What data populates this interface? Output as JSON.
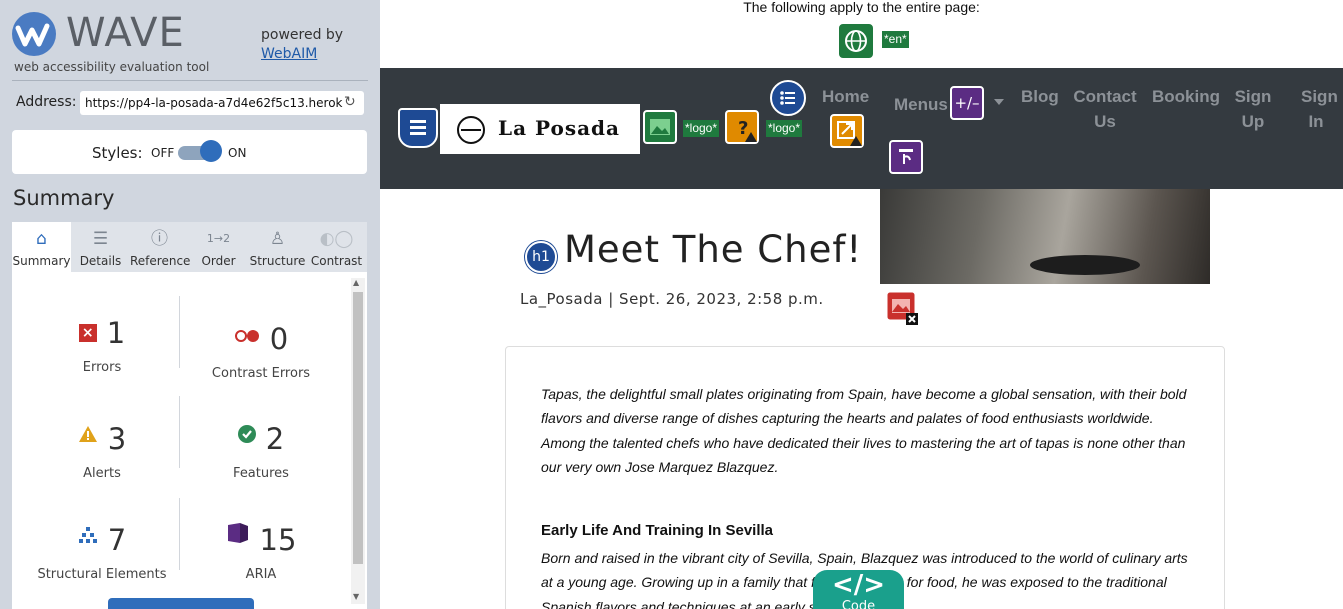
{
  "wave": {
    "name": "WAVE",
    "tagline": "web accessibility evaluation tool",
    "powered_by": "powered by",
    "webaim": "WebAIM",
    "address_label": "Address:",
    "address_value": "https://pp4-la-posada-a7d4e62f5c13.herok",
    "styles_label": "Styles:",
    "styles_off": "OFF",
    "styles_on": "ON",
    "summary_heading": "Summary",
    "tabs": [
      {
        "label": "Summary",
        "icon": "home-icon"
      },
      {
        "label": "Details",
        "icon": "list-icon"
      },
      {
        "label": "Reference",
        "icon": "info-icon"
      },
      {
        "label": "Order",
        "icon": "order-icon"
      },
      {
        "label": "Structure",
        "icon": "structure-icon"
      },
      {
        "label": "Contrast",
        "icon": "contrast-icon"
      }
    ],
    "stats": {
      "errors": {
        "count": "1",
        "label": "Errors"
      },
      "contrast_errors": {
        "count": "0",
        "label": "Contrast Errors"
      },
      "alerts": {
        "count": "3",
        "label": "Alerts"
      },
      "features": {
        "count": "2",
        "label": "Features"
      },
      "structural": {
        "count": "7",
        "label": "Structural Elements"
      },
      "aria": {
        "count": "15",
        "label": "ARIA"
      }
    },
    "colors": {
      "error": "#c9302c",
      "alert": "#e0a21a",
      "feature": "#2e8b57",
      "aria": "#5b2c83",
      "accent": "#2f6dbb"
    }
  },
  "page": {
    "notice": "The following apply to the entire page:",
    "lang_badge": "*en*",
    "logo_badge_1": "*logo*",
    "logo_badge_2": "*logo*",
    "brand": "La Posada",
    "nav": {
      "home": "Home",
      "menus": "Menus",
      "blog": "Blog",
      "contact": "Contact Us",
      "booking": "Booking",
      "signup": "Sign Up",
      "signin": "Sign In"
    },
    "aria_menu_label": "+/–",
    "h1_badge": "h1",
    "title": "Meet The Chef!",
    "byline": "La_Posada | Sept. 26, 2023, 2:58 p.m.",
    "intro": "Tapas, the delightful small plates originating from Spain, have become a global sensation, with their bold flavors and diverse range of dishes capturing the hearts and palates of food enthusiasts worldwide. Among the talented chefs who have dedicated their lives to mastering the art of tapas is none other than our very own Jose Marquez Blazquez.",
    "section_heading": "Early Life And Training In Sevilla",
    "section_text": "Born and raised in the vibrant city of Sevilla, Spain, Blazquez was introduced to the world of culinary arts at a young age. Growing up in a family that fostered a love for food, he was exposed to the traditional Spanish flavors and techniques at an early stage.",
    "code_label": "Code",
    "code_glyph": "</>"
  }
}
